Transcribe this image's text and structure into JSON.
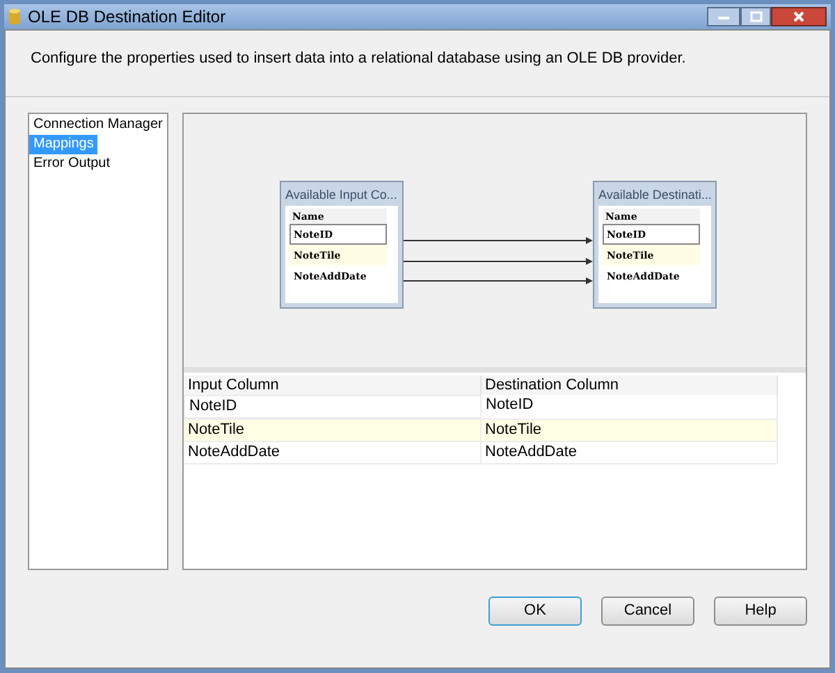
{
  "window": {
    "title": "OLE DB Destination Editor"
  },
  "description": "Configure the properties used to insert data into a relational database using an OLE DB provider.",
  "sidebar": {
    "items": [
      {
        "label": "Connection Manager",
        "selected": false
      },
      {
        "label": "Mappings",
        "selected": true
      },
      {
        "label": "Error Output",
        "selected": false
      }
    ]
  },
  "diagram": {
    "tables": [
      {
        "title": "Available Input Co...",
        "header": "Name",
        "rows": [
          {
            "label": "NoteID",
            "focused": true,
            "highlighted": false
          },
          {
            "label": "NoteTile",
            "focused": false,
            "highlighted": true
          },
          {
            "label": "NoteAddDate",
            "focused": false,
            "highlighted": false
          }
        ]
      },
      {
        "title": "Available Destinati...",
        "header": "Name",
        "rows": [
          {
            "label": "NoteID",
            "focused": true,
            "highlighted": false
          },
          {
            "label": "NoteTile",
            "focused": false,
            "highlighted": true
          },
          {
            "label": "NoteAddDate",
            "focused": false,
            "highlighted": false
          }
        ]
      }
    ],
    "links": [
      {
        "mapped": true
      },
      {
        "mapped": true
      },
      {
        "mapped": true
      }
    ]
  },
  "table": {
    "columns": [
      "Input Column",
      "Destination Column"
    ],
    "rows": [
      {
        "cells": [
          "NoteID",
          "NoteID"
        ],
        "focused": true,
        "highlighted": false
      },
      {
        "cells": [
          "NoteTile",
          "NoteTile"
        ],
        "focused": false,
        "highlighted": true
      },
      {
        "cells": [
          "NoteAddDate",
          "NoteAddDate"
        ],
        "focused": false,
        "highlighted": false
      }
    ]
  },
  "buttons": [
    {
      "label": "OK",
      "default": true
    },
    {
      "label": "Cancel",
      "default": false
    },
    {
      "label": "Help",
      "default": false
    }
  ]
}
